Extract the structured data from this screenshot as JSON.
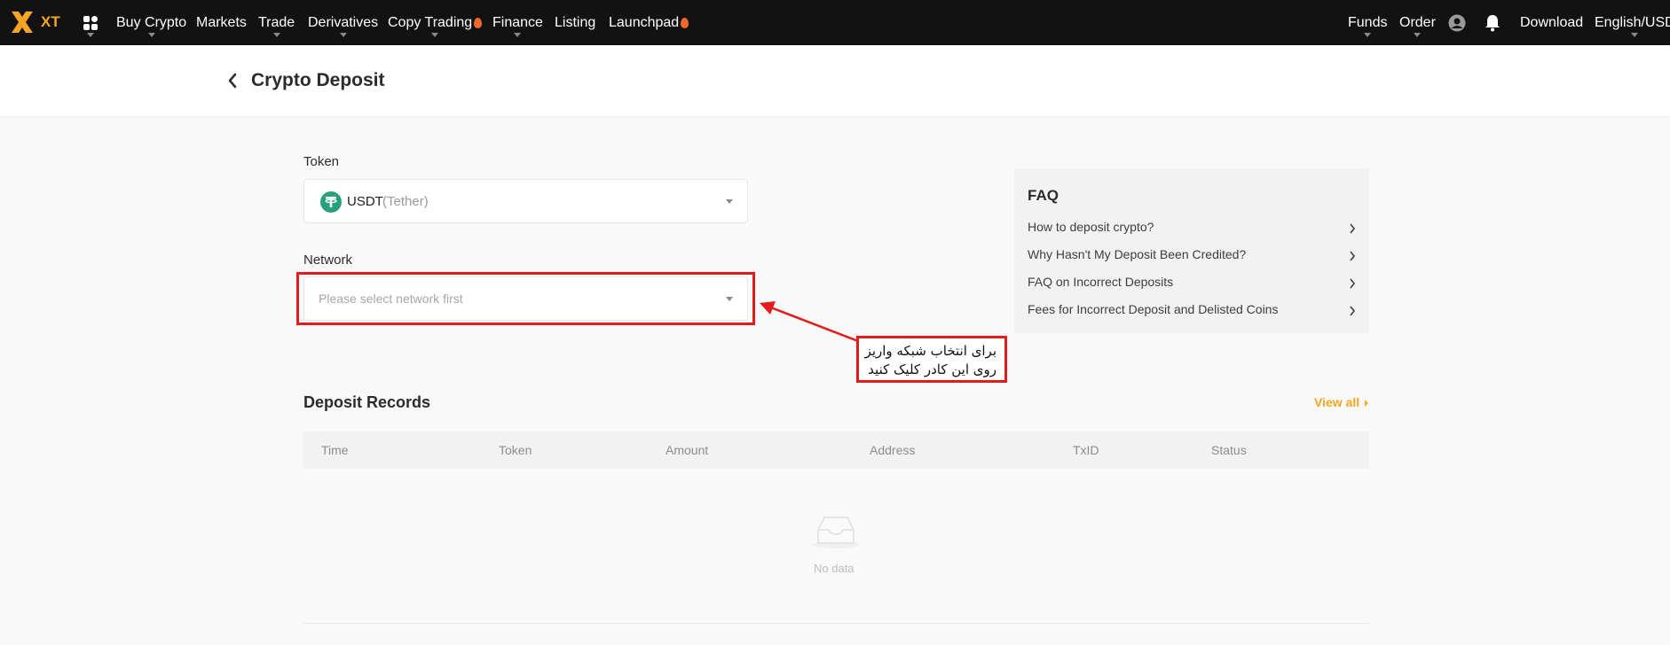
{
  "nav": {
    "logo_text": "XT",
    "items": [
      "Buy Crypto",
      "Markets",
      "Trade",
      "Derivatives",
      "Copy Trading",
      "Finance",
      "Listing",
      "Launchpad"
    ],
    "right": {
      "funds": "Funds",
      "order": "Order",
      "download": "Download",
      "language": "English/USD"
    }
  },
  "header": {
    "title": "Crypto Deposit"
  },
  "token": {
    "label": "Token",
    "symbol": "USDT",
    "name": "(Tether)",
    "icon": "tether-icon",
    "icon_color": "#26a17b"
  },
  "network": {
    "label": "Network",
    "placeholder": "Please select network first"
  },
  "annotation": {
    "line1": "برای انتخاب شبکه واریز",
    "line2": "روی این کادر کلیک کنید",
    "color": "#e51b1b"
  },
  "faq": {
    "title": "FAQ",
    "items": [
      "How to deposit crypto?",
      "Why Hasn't My Deposit Been Credited?",
      "FAQ on Incorrect Deposits",
      "Fees for Incorrect Deposit and Delisted Coins"
    ]
  },
  "records": {
    "title": "Deposit Records",
    "view_all": "View all",
    "columns": [
      "Time",
      "Token",
      "Amount",
      "Address",
      "TxID",
      "Status"
    ],
    "empty_text": "No data"
  },
  "colors": {
    "accent": "#f5a623",
    "topbar": "#121212"
  }
}
